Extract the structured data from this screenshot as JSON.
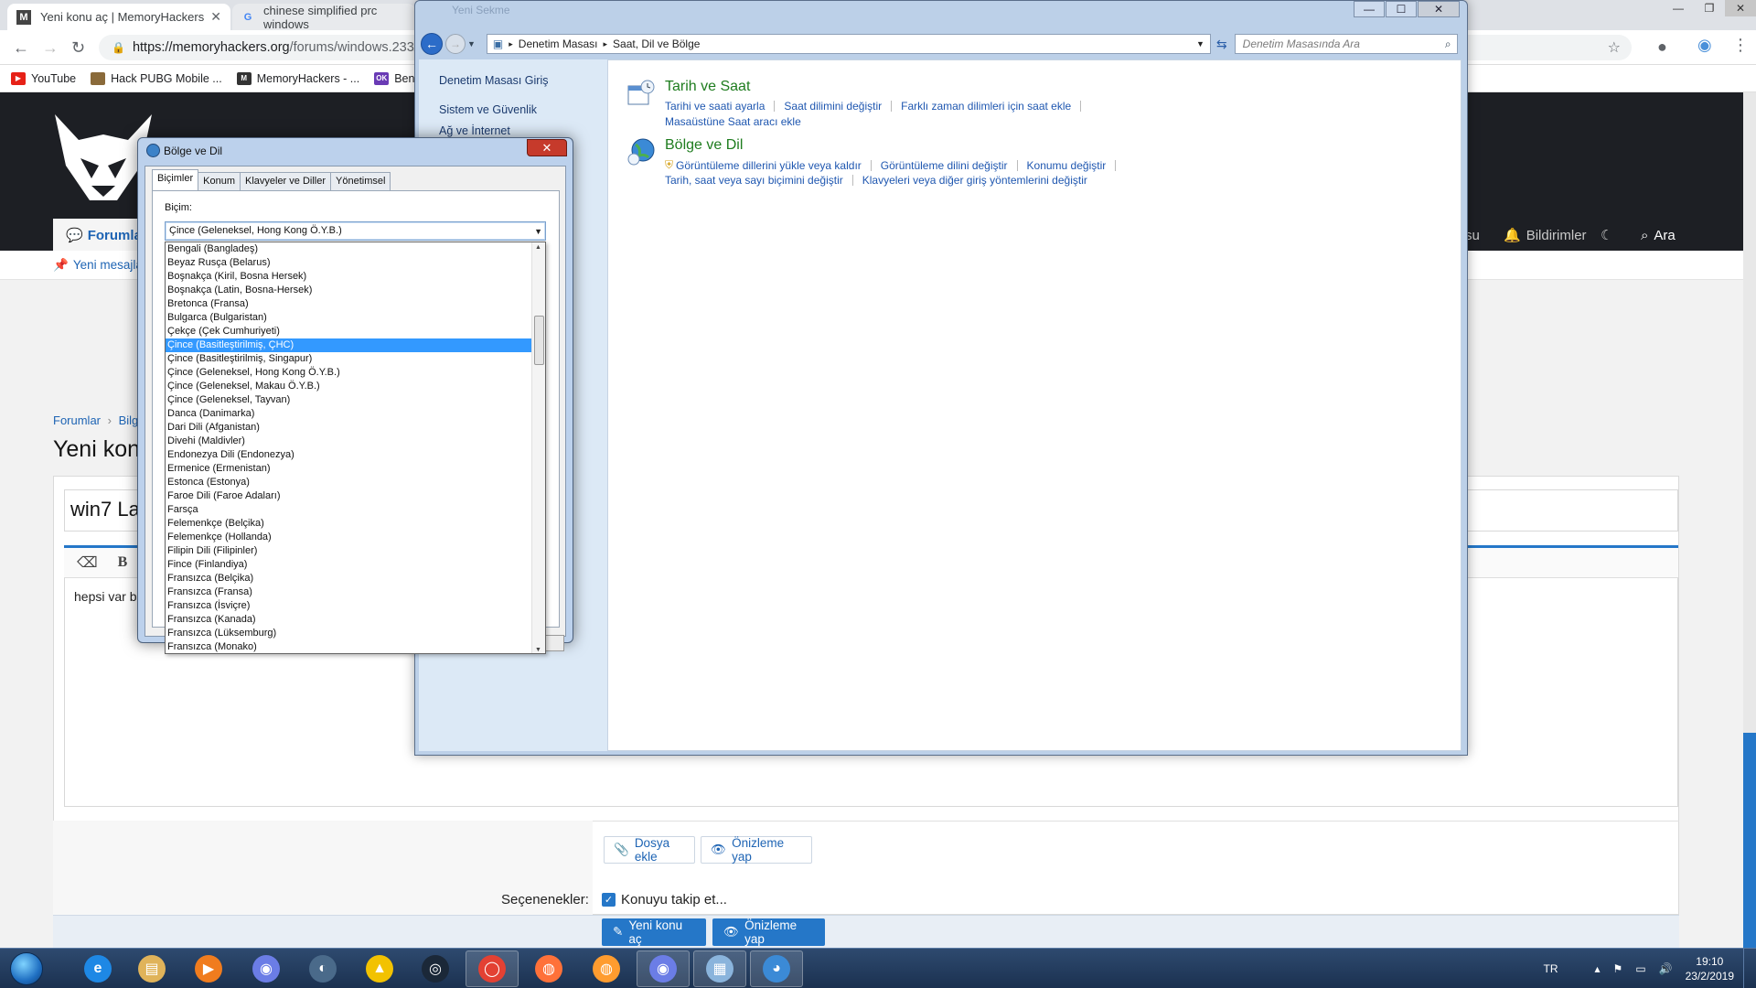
{
  "chrome": {
    "tabs": [
      {
        "title": "Yeni konu aç | MemoryHackers",
        "icon": "memoryhackers-favicon"
      },
      {
        "title": "chinese simplified prc windows",
        "icon": "google-favicon"
      }
    ],
    "url_host": "https://memoryhackers.org",
    "url_path": "/forums/windows.233/p",
    "bookmarks": [
      {
        "label": "YouTube",
        "color": "#e62117"
      },
      {
        "label": "Hack PUBG Mobile ...",
        "color": "#8a6a3a"
      },
      {
        "label": "MemoryHackers - ...",
        "color": "#333333"
      },
      {
        "label": "Ben",
        "color": "#6a3bb5"
      }
    ]
  },
  "site": {
    "nav_active": "Forumlar",
    "nav_partial": "su",
    "nav_notifications": "Bildirimler",
    "nav_search": "Ara",
    "subnav_link": "Yeni mesajlar",
    "breadcrumb_root": "Forumlar",
    "breadcrumb_sep": "›",
    "breadcrumb_next": "Bilg",
    "page_title": "Yeni kon",
    "thread_title": "win7 La",
    "editor_body": "hepsi var b",
    "attach_button": "Dosya ekle",
    "preview_button": "Önizleme yap",
    "options_label": "Seçenenekler:",
    "follow_label": "Konuyu takip et...",
    "submit_button": "Yeni konu aç",
    "submit_preview": "Önizleme yap"
  },
  "control_panel": {
    "title_ghost": "Yeni Sekme",
    "breadcrumb": [
      "Denetim Masası",
      "Saat, Dil ve Bölge"
    ],
    "search_placeholder": "Denetim Masasında Ara",
    "left_links": [
      "Denetim Masası Giriş",
      "Sistem ve Güvenlik",
      "Ağ ve İnternet"
    ],
    "categories": [
      {
        "title": "Tarih ve Saat",
        "links": [
          "Tarihi ve saati ayarla",
          "Saat dilimini değiştir",
          "Farklı zaman dilimleri için saat ekle"
        ],
        "links2": [
          "Masaüstüne Saat aracı ekle"
        ]
      },
      {
        "title": "Bölge ve Dil",
        "links": [
          "Görüntüleme dillerini yükle veya kaldır",
          "Görüntüleme dilini değiştir",
          "Konumu değiştir"
        ],
        "links2": [
          "Tarih, saat veya sayı biçimini değiştir",
          "Klavyeleri veya diğer giriş yöntemlerini değiştir"
        ]
      }
    ]
  },
  "dialog": {
    "title": "Bölge ve Dil",
    "tabs": [
      "Biçimler",
      "Konum",
      "Klavyeler ve Diller",
      "Yönetimsel"
    ],
    "format_label": "Biçim:",
    "format_value": "Çince (Geleneksel, Hong Kong Ö.Y.B.)",
    "selected_index": 7,
    "options": [
      "Bengali (Bangladeş)",
      "Beyaz Rusça (Belarus)",
      "Boşnakça (Kiril, Bosna Hersek)",
      "Boşnakça (Latin, Bosna-Hersek)",
      "Bretonca (Fransa)",
      "Bulgarca (Bulgaristan)",
      "Çekçe (Çek Cumhuriyeti)",
      "Çince (Basitleştirilmiş, ÇHC)",
      "Çince (Basitleştirilmiş, Singapur)",
      "Çince (Geleneksel, Hong Kong Ö.Y.B.)",
      "Çince (Geleneksel, Makau Ö.Y.B.)",
      "Çince (Geleneksel, Tayvan)",
      "Danca (Danimarka)",
      "Dari Dili (Afganistan)",
      "Divehi (Maldivler)",
      "Endonezya Dili (Endonezya)",
      "Ermenice (Ermenistan)",
      "Estonca (Estonya)",
      "Faroe Dili (Faroe Adaları)",
      "Farsça",
      "Felemenkçe (Belçika)",
      "Felemenkçe (Hollanda)",
      "Filipin Dili (Filipinler)",
      "Fince (Finlandiya)",
      "Fransızca (Belçika)",
      "Fransızca (Fransa)",
      "Fransızca (İsviçre)",
      "Fransızca (Kanada)",
      "Fransızca (Lüksemburg)",
      "Fransızca (Monako)"
    ]
  },
  "taskbar": {
    "items": [
      "ie-icon",
      "explorer-icon",
      "media-player-icon",
      "discord-icon",
      "teamspeak-icon",
      "arma-icon",
      "steam-icon",
      "chrome-icon",
      "firefox-icon",
      "firefox-dev-icon",
      "discord-notify-icon",
      "control-panel-icon",
      "region-icon"
    ],
    "language": "TR",
    "time": "19:10",
    "date": "23/2/2019"
  }
}
